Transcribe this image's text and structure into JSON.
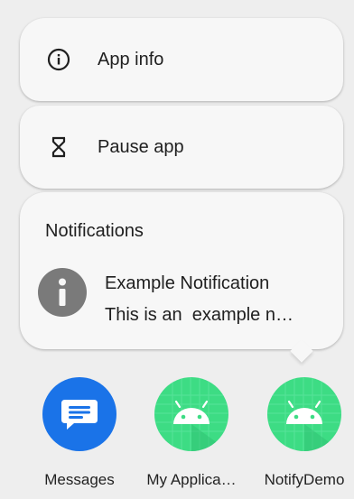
{
  "shortcuts": {
    "app_info": {
      "label": "App info",
      "icon": "info-icon"
    },
    "pause_app": {
      "label": "Pause app",
      "icon": "hourglass-icon"
    }
  },
  "notifications": {
    "title": "Notifications",
    "item": {
      "icon": "info-icon",
      "heading": "Example Notification",
      "body": "This is an  example n…"
    }
  },
  "apps": [
    {
      "label": "Messages",
      "icon": "messages-icon",
      "color": "#1a73e8"
    },
    {
      "label": "My Applica…",
      "icon": "android-icon",
      "color": "#3ddc84"
    },
    {
      "label": "NotifyDemo",
      "icon": "android-icon",
      "color": "#3ddc84"
    }
  ]
}
